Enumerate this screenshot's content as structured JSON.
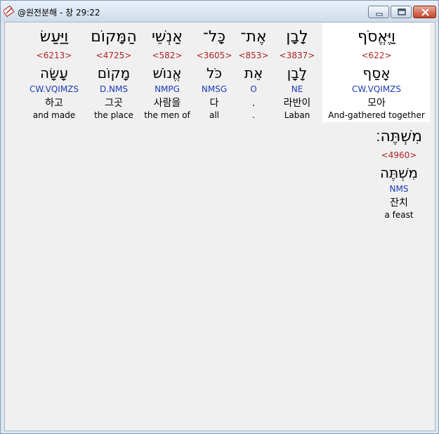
{
  "window": {
    "title": "@원전분해 - 창 29:22"
  },
  "words": [
    {
      "hebrew": "וַיֶּאֱסֹף",
      "strong": "<622>",
      "lemma": "אָסַף",
      "morph": "CW.VQIMZS",
      "korean": "모아",
      "english": "And-gathered together"
    },
    {
      "hebrew": "לָבָן",
      "strong": "<3837>",
      "lemma": "לָבָן",
      "morph": "NE",
      "korean": "라반이",
      "english": "Laban"
    },
    {
      "hebrew": "אֶת־",
      "strong": "<853>",
      "lemma": "אֵת",
      "morph": "O",
      "korean": ".",
      "english": "."
    },
    {
      "hebrew": "כָּל־",
      "strong": "<3605>",
      "lemma": "כֹּל",
      "morph": "NMSG",
      "korean": "다",
      "english": "all"
    },
    {
      "hebrew": "אַנְשֵׁי",
      "strong": "<582>",
      "lemma": "אֱנוֹשׁ",
      "morph": "NMPG",
      "korean": "사람을",
      "english": "the men of"
    },
    {
      "hebrew": "הַמָּקוֹם",
      "strong": "<4725>",
      "lemma": "מָקוֹם",
      "morph": "D.NMS",
      "korean": "그곳",
      "english": "the place"
    },
    {
      "hebrew": "וַיַּעַשׂ",
      "strong": "<6213>",
      "lemma": "עָשָׂה",
      "morph": "CW.VQIMZS",
      "korean": "하고",
      "english": "and made"
    },
    {
      "hebrew": "מִשְׁתֶּה׃",
      "strong": "<4960>",
      "lemma": "מִשְׁתֶּה",
      "morph": "NMS",
      "korean": "잔치",
      "english": "a feast"
    }
  ]
}
